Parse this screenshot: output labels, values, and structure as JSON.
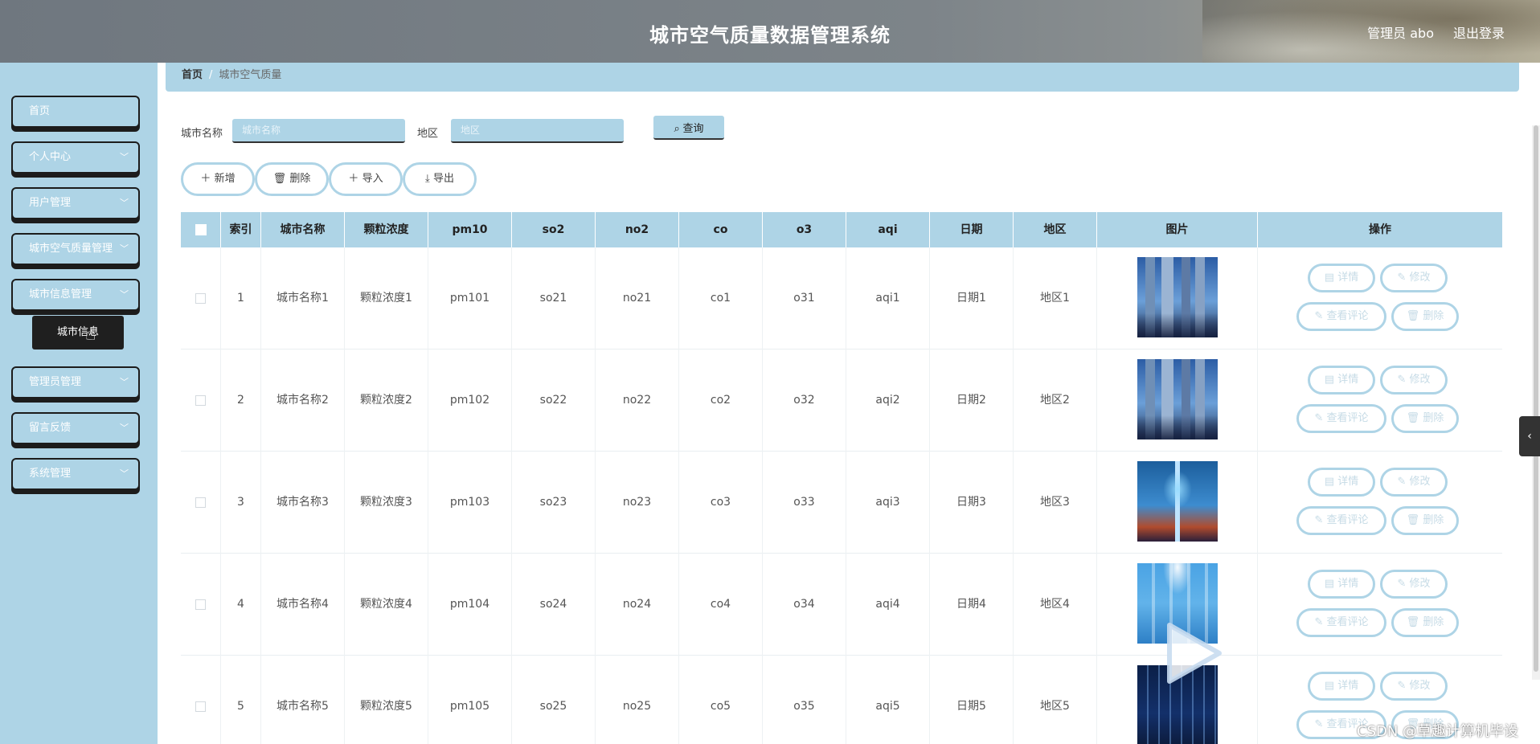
{
  "header": {
    "title": "城市空气质量数据管理系统",
    "user": "管理员 abo",
    "logout": "退出登录"
  },
  "sidebar": {
    "items": [
      {
        "label": "首页",
        "chevron": false
      },
      {
        "label": "个人中心",
        "chevron": true
      },
      {
        "label": "用户管理",
        "chevron": true
      },
      {
        "label": "城市空气质量管理",
        "chevron": true
      },
      {
        "label": "城市信息管理",
        "chevron": true
      },
      {
        "label": "管理员管理",
        "chevron": true
      },
      {
        "label": "留言反馈",
        "chevron": true
      },
      {
        "label": "系统管理",
        "chevron": true
      }
    ],
    "tooltip": "城市信息"
  },
  "breadcrumb": {
    "home": "首页",
    "sep": "/",
    "current": "城市空气质量"
  },
  "search": {
    "city_label": "城市名称",
    "city_placeholder": "城市名称",
    "area_label": "地区",
    "area_placeholder": "地区",
    "query_label": "查询"
  },
  "actions": {
    "add": "新增",
    "delete": "删除",
    "import": "导入",
    "export": "导出"
  },
  "table": {
    "headers": [
      "索引",
      "城市名称",
      "颗粒浓度",
      "pm10",
      "so2",
      "no2",
      "co",
      "o3",
      "aqi",
      "日期",
      "地区",
      "图片",
      "操作"
    ],
    "rows": [
      {
        "index": "1",
        "city": "城市名称1",
        "particle": "颗粒浓度1",
        "pm10": "pm101",
        "so2": "so21",
        "no2": "no21",
        "co": "co1",
        "o3": "o31",
        "aqi": "aqi1",
        "date": "日期1",
        "area": "地区1"
      },
      {
        "index": "2",
        "city": "城市名称2",
        "particle": "颗粒浓度2",
        "pm10": "pm102",
        "so2": "so22",
        "no2": "no22",
        "co": "co2",
        "o3": "o32",
        "aqi": "aqi2",
        "date": "日期2",
        "area": "地区2"
      },
      {
        "index": "3",
        "city": "城市名称3",
        "particle": "颗粒浓度3",
        "pm10": "pm103",
        "so2": "so23",
        "no2": "no23",
        "co": "co3",
        "o3": "o33",
        "aqi": "aqi3",
        "date": "日期3",
        "area": "地区3"
      },
      {
        "index": "4",
        "city": "城市名称4",
        "particle": "颗粒浓度4",
        "pm10": "pm104",
        "so2": "so24",
        "no2": "no24",
        "co": "co4",
        "o3": "o34",
        "aqi": "aqi4",
        "date": "日期4",
        "area": "地区4"
      },
      {
        "index": "5",
        "city": "城市名称5",
        "particle": "颗粒浓度5",
        "pm10": "pm105",
        "so2": "so25",
        "no2": "no25",
        "co": "co5",
        "o3": "o35",
        "aqi": "aqi5",
        "date": "日期5",
        "area": "地区5"
      }
    ],
    "ops": {
      "detail": "详情",
      "edit": "修改",
      "comments": "查看评论",
      "delete": "删除"
    }
  },
  "watermark": "CSDN @草趣计算机毕设",
  "colors": {
    "accent": "#aed4e6",
    "dark": "#1c1c1c"
  }
}
